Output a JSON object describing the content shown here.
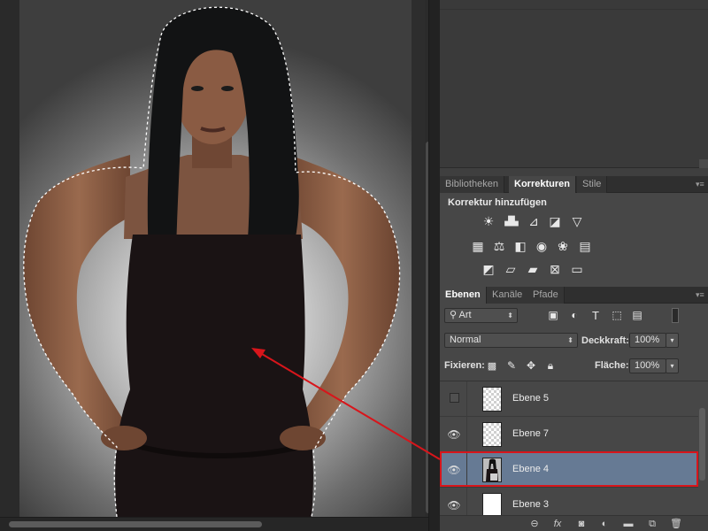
{
  "panels": {
    "top_tabs": [
      {
        "label": "Bibliotheken",
        "active": false
      },
      {
        "label": "Korrekturen",
        "active": true
      },
      {
        "label": "Stile",
        "active": false
      }
    ],
    "korrekturen": {
      "title": "Korrektur hinzufügen",
      "icons": [
        [
          "brightness-contrast-icon",
          "levels-icon",
          "curves-icon",
          "exposure-icon",
          "vibrance-icon"
        ],
        [
          "hue-saturation-icon",
          "color-balance-icon",
          "black-white-icon",
          "photo-filter-icon",
          "channel-mixer-icon",
          "color-lookup-icon"
        ],
        [
          "invert-icon",
          "posterize-icon",
          "threshold-icon",
          "selective-color-icon",
          "gradient-map-icon"
        ]
      ]
    },
    "layers_tabs": [
      {
        "label": "Ebenen",
        "active": true
      },
      {
        "label": "Kanäle",
        "active": false
      },
      {
        "label": "Pfade",
        "active": false
      }
    ],
    "filter": {
      "value": "Art"
    },
    "blend_mode": {
      "value": "Normal"
    },
    "opacity": {
      "label": "Deckkraft:",
      "value": "100%"
    },
    "lock": {
      "label": "Fixieren:"
    },
    "fill": {
      "label": "Fläche:",
      "value": "100%"
    },
    "layers": [
      {
        "name": "Ebene 5",
        "visible": false,
        "selected": false,
        "thumb": "transparent"
      },
      {
        "name": "Ebene 7",
        "visible": true,
        "selected": false,
        "thumb": "transparent"
      },
      {
        "name": "Ebene 4",
        "visible": true,
        "selected": true,
        "thumb": "photo"
      },
      {
        "name": "Ebene 3",
        "visible": true,
        "selected": false,
        "thumb": "white"
      }
    ],
    "footer_icons": [
      "link-icon",
      "fx-icon",
      "mask-icon",
      "adjustment-icon",
      "folder-icon",
      "new-layer-icon",
      "trash-icon"
    ]
  },
  "colors": {
    "annotation_red": "#d8151b",
    "selected_row": "#667a94"
  }
}
